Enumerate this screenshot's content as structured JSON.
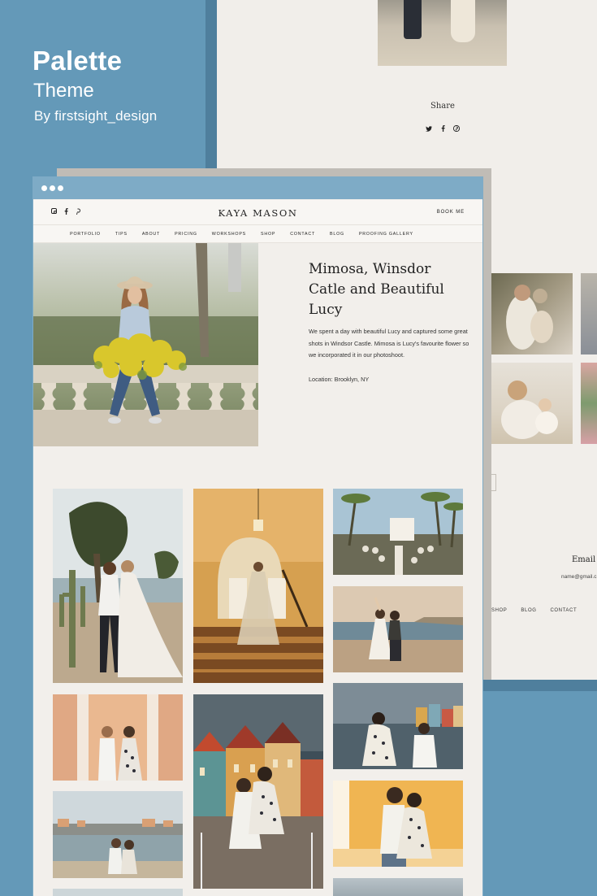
{
  "promo": {
    "title": "Palette",
    "subtitle": "Theme",
    "byline": "By firstsight_design"
  },
  "background_page": {
    "share_label": "Share",
    "share_icons": [
      "twitter-icon",
      "facebook-icon",
      "pinterest-icon"
    ],
    "email_label": "Email",
    "email_value": "name@gmail.c",
    "nav": [
      "SHOP",
      "BLOG",
      "CONTACT"
    ]
  },
  "site": {
    "logo": "KAYA MASON",
    "book_me": "BOOK ME",
    "social_icons": [
      "instagram-icon",
      "facebook-icon",
      "pinterest-icon"
    ],
    "nav": [
      "PORTFOLIO",
      "TIPS",
      "ABOUT",
      "PRICING",
      "WORKSHOPS",
      "SHOP",
      "CONTACT",
      "BLOG",
      "PROOFING GALLERY"
    ]
  },
  "post": {
    "title": "Mimosa, Winsdor Catle and Beautiful Lucy",
    "body": "We spent a day with beautiful Lucy and captured some great shots in Windsor Castle. Mimosa is Lucy's favourite flower so we incorporated it in our photoshoot.",
    "location": "Location: Brooklyn, NY"
  },
  "colors": {
    "brand_blue": "#6499b8",
    "titlebar_blue": "#7eabc6",
    "page_bg": "#f2efeb"
  }
}
